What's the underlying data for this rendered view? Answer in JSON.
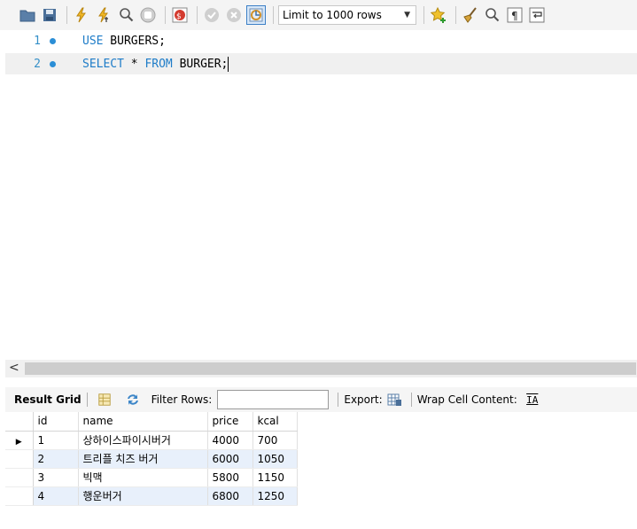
{
  "toolbar": {
    "icons": [
      "open-folder-icon",
      "save-icon",
      "execute-lightning-icon",
      "execute-cursor-icon",
      "explain-magnifier-icon",
      "stop-icon",
      "toggle-stop-on-error-icon",
      "commit-icon",
      "rollback-icon",
      "autocommit-icon"
    ],
    "limit_select_value": "Limit to 1000 rows",
    "right_icons": [
      "add-snippet-star-icon",
      "beautify-broom-icon",
      "find-icon",
      "invisible-chars-icon",
      "wrap-lines-icon"
    ]
  },
  "editor": {
    "lines": [
      {
        "number": "1",
        "keyword1": "USE",
        "text1": " BURGERS;",
        "keyword2": "",
        "text2": "",
        "keyword3": "",
        "text3": ""
      },
      {
        "number": "2",
        "keyword1": "SELECT",
        "text1": " * ",
        "keyword2": "FROM",
        "text2": " BURGER;",
        "keyword3": "",
        "text3": ""
      }
    ]
  },
  "scrollbar": {
    "left_arrow": "<"
  },
  "result_toolbar": {
    "result_grid_label": "Result Grid",
    "filter_rows_label": "Filter Rows:",
    "filter_rows_value": "",
    "export_label": "Export:",
    "wrap_cell_label": "Wrap Cell Content:",
    "wrap_icon_glyph": "IA"
  },
  "grid": {
    "columns": [
      "id",
      "name",
      "price",
      "kcal"
    ],
    "rows": [
      [
        "1",
        "상하이스파이시버거",
        "4000",
        "700"
      ],
      [
        "2",
        "트리플 치즈 버거",
        "6000",
        "1050"
      ],
      [
        "3",
        "빅맥",
        "5800",
        "1150"
      ],
      [
        "4",
        "행운버거",
        "6800",
        "1250"
      ]
    ],
    "current_row_marker": "▶"
  }
}
